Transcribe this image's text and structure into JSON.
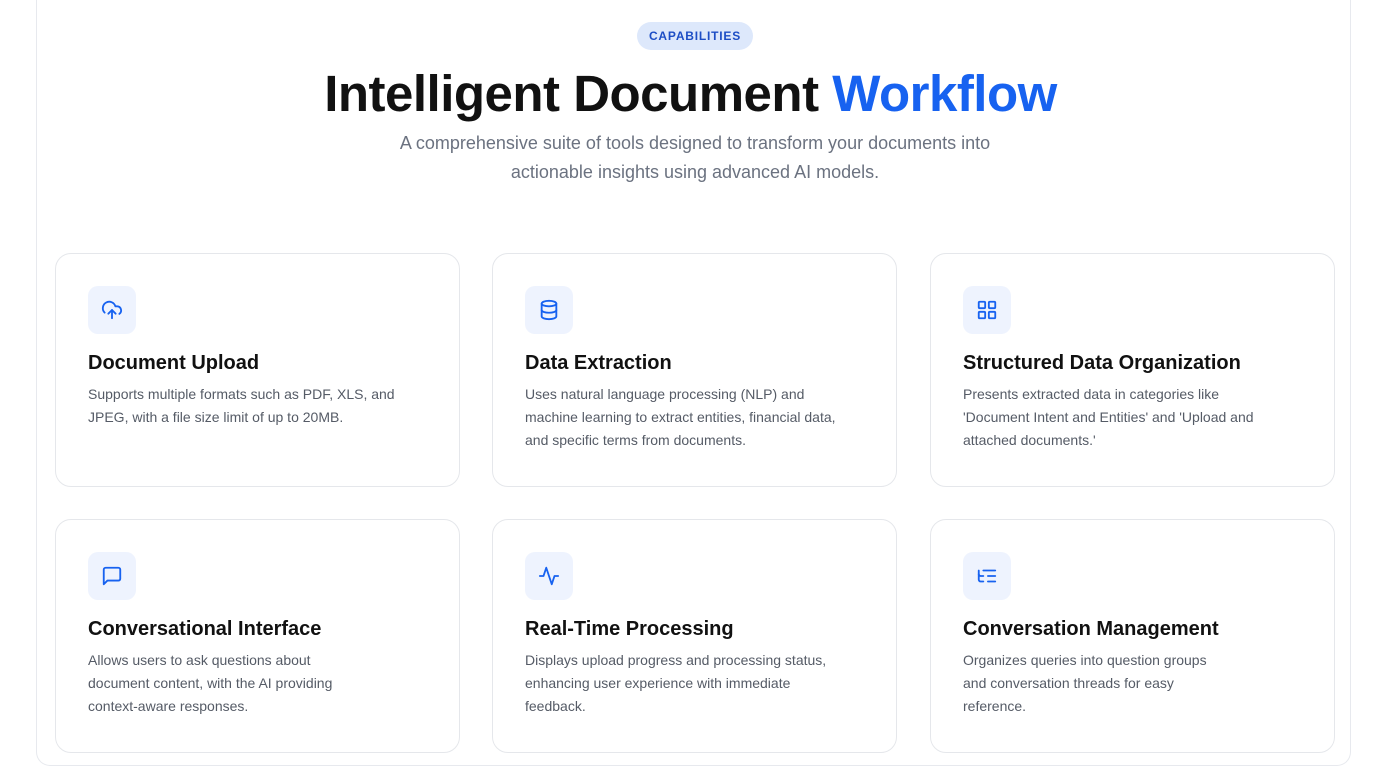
{
  "badge": "CAPABILITIES",
  "title": {
    "main": "Intelligent Document ",
    "accent": "Workflow"
  },
  "subtitle": {
    "line1": "A comprehensive suite of tools designed to transform your documents into",
    "line2": "actionable insights using advanced AI models."
  },
  "colors": {
    "accent": "#1762f0",
    "badge_bg": "#dde8fb",
    "icon_bg": "#eef3fe",
    "text_dark": "#111111",
    "text_muted": "#6b7280"
  },
  "features": [
    {
      "icon": "cloud-upload-icon",
      "title": "Document Upload",
      "desc": [
        "Supports multiple formats such as PDF, XLS, and",
        "JPEG, with a file size limit of up to 20MB."
      ]
    },
    {
      "icon": "database-icon",
      "title": "Data Extraction",
      "desc": [
        "Uses natural language processing (NLP) and",
        "machine learning to extract entities, financial data,",
        "and specific terms from documents."
      ]
    },
    {
      "icon": "grid-icon",
      "title": "Structured Data Organization",
      "desc": [
        "Presents extracted data in categories like",
        "'Document Intent and Entities' and 'Upload and",
        "attached documents.'"
      ]
    },
    {
      "icon": "message-square-icon",
      "title": "Conversational Interface",
      "desc": [
        "Allows users to ask questions about",
        "document content, with the AI providing",
        "context-aware responses."
      ]
    },
    {
      "icon": "activity-icon",
      "title": "Real-Time Processing",
      "desc": [
        "Displays upload progress and processing status,",
        "enhancing user experience with immediate",
        "feedback."
      ]
    },
    {
      "icon": "list-tree-icon",
      "title": "Conversation Management",
      "desc": [
        "Organizes queries into question groups",
        "and conversation threads for easy",
        "reference."
      ]
    }
  ]
}
